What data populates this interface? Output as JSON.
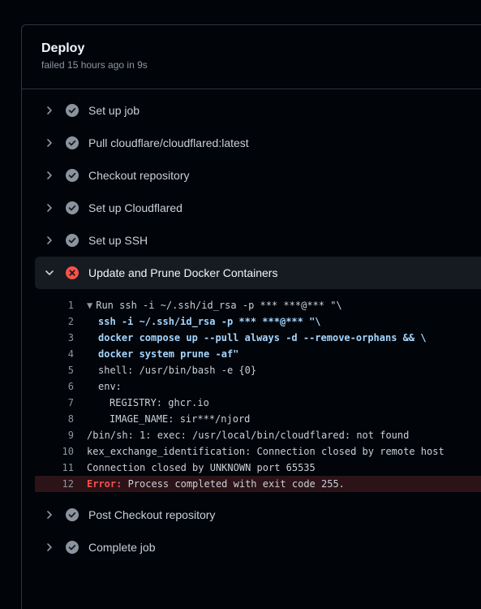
{
  "job": {
    "title": "Deploy",
    "subtitle": "failed 15 hours ago in 9s"
  },
  "steps_before": [
    {
      "label": "Set up job",
      "status": "success"
    },
    {
      "label": "Pull cloudflare/cloudflared:latest",
      "status": "success"
    },
    {
      "label": "Checkout repository",
      "status": "success"
    },
    {
      "label": "Set up Cloudflared",
      "status": "success"
    },
    {
      "label": "Set up SSH",
      "status": "success"
    }
  ],
  "active_step": {
    "label": "Update and Prune Docker Containers",
    "status": "failure"
  },
  "log_lines": [
    {
      "num": "1",
      "text": "Run ssh -i ~/.ssh/id_rsa -p *** ***@*** \"\\"
    },
    {
      "num": "2",
      "text": "ssh -i ~/.ssh/id_rsa -p *** ***@*** \"\\"
    },
    {
      "num": "3",
      "text": "docker compose up --pull always -d --remove-orphans && \\"
    },
    {
      "num": "4",
      "text": "docker system prune -af\""
    },
    {
      "num": "5",
      "text": "shell: /usr/bin/bash -e {0}"
    },
    {
      "num": "6",
      "text": "env:"
    },
    {
      "num": "7",
      "text": "REGISTRY: ghcr.io"
    },
    {
      "num": "8",
      "text": "IMAGE_NAME: sir***/njord"
    },
    {
      "num": "9",
      "text": "/bin/sh: 1: exec: /usr/local/bin/cloudflared: not found"
    },
    {
      "num": "10",
      "text": "kex_exchange_identification: Connection closed by remote host"
    },
    {
      "num": "11",
      "text": "Connection closed by UNKNOWN port 65535"
    },
    {
      "num": "12",
      "error_label": "Error:",
      "text": " Process completed with exit code 255."
    }
  ],
  "steps_after": [
    {
      "label": "Post Checkout repository",
      "status": "success"
    },
    {
      "label": "Complete job",
      "status": "success"
    }
  ],
  "colors": {
    "success": "#8b949e",
    "failure": "#f85149",
    "background": "#010409"
  },
  "icons": {
    "collapsed": "chevron-right-icon",
    "expanded": "chevron-down-icon",
    "success": "check-circle-icon",
    "failure": "x-circle-icon"
  }
}
